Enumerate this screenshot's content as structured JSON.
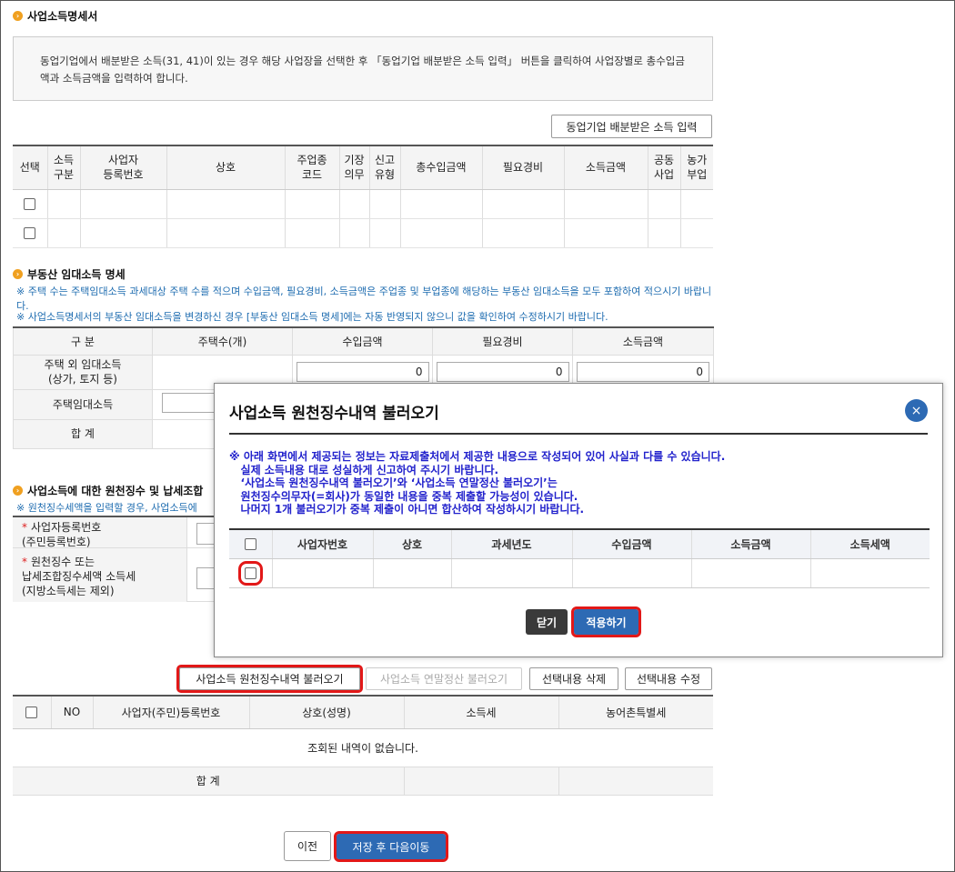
{
  "section1": {
    "title": "사업소득명세서",
    "info": "동업기업에서 배분받은 소득(31, 41)이 있는 경우 해당 사업장을 선택한 후 「동업기업 배분받은 소득 입력」 버튼을 클릭하여 사업장별로 총수입금액과 소득금액을 입력하여 합니다.",
    "partner_button": "동업기업 배분받은 소득 입력",
    "columns": [
      "선택",
      "소득\n구분",
      "사업자\n등록번호",
      "상호",
      "주업종\n코드",
      "기장\n의무",
      "신고\n유형",
      "총수입금액",
      "필요경비",
      "소득금액",
      "공동\n사업",
      "농가\n부업"
    ]
  },
  "section2": {
    "title": "부동산 임대소득 명세",
    "note1": "※ 주택 수는 주택임대소득 과세대상 주택 수를 적으며 수입금액, 필요경비, 소득금액은 주업종 및 부업종에 해당하는 부동산 임대소득을 모두 포함하여 적으시기 바랍니다.",
    "note2": "※ 사업소득명세서의 부동산 임대소득을 변경하신 경우 [부동산 임대소득 명세]에는 자동 반영되지 않으니 값을 확인하여 수정하시기 바랍니다.",
    "headers": [
      "구 분",
      "주택수(개)",
      "수입금액",
      "필요경비",
      "소득금액"
    ],
    "row1_label": "주택 외 임대소득\n(상가, 토지 등)",
    "row1_values": [
      "0",
      "0",
      "0"
    ],
    "row2_label": "주택임대소득",
    "row3_label": "합 계"
  },
  "section3": {
    "title": "사업소득에 대한 원천징수 및 납세조합",
    "note": "※ 원천징수세액을 입력할 경우, 사업소득에",
    "field1_label": "사업자등록번호\n(주민등록번호)",
    "field2_label": "원천징수 또는\n납세조합징수세액 소득세\n(지방소득세는 제외)"
  },
  "buttons": {
    "withholding_load": "사업소득 원천징수내역 불러오기",
    "yearend_load": "사업소득 연말정산 불러오기",
    "delete_selected": "선택내용 삭제",
    "edit_selected": "선택내용 수정",
    "prev": "이전",
    "save_next": "저장 후 다음이동"
  },
  "list": {
    "headers": [
      "NO",
      "사업자(주민)등록번호",
      "상호(성명)",
      "소득세",
      "농어촌특별세"
    ],
    "empty": "조회된 내역이 없습니다.",
    "total": "합 계"
  },
  "modal": {
    "title": "사업소득 원천징수내역 불러오기",
    "close": "×",
    "warning": "※ 아래 화면에서 제공되는 정보는 자료제출처에서 제공한 내용으로 작성되어 있어 사실과 다를 수 있습니다.\n   실제 소득내용 대로 성실하게 신고하여 주시기 바랍니다.\n   ‘사업소득 원천징수내역 불러오기’와 ‘사업소득 연말정산 불러오기’는\n   원천징수의무자(=회사)가 동일한 내용을 중복 제출할 가능성이 있습니다.\n   나머지 1개 불러오기가 중복 제출이 아니면 합산하여 작성하시기 바랍니다.",
    "headers": [
      "사업자번호",
      "상호",
      "과세년도",
      "수입금액",
      "소득금액",
      "소득세액"
    ],
    "close_button": "닫기",
    "apply_button": "적용하기"
  }
}
